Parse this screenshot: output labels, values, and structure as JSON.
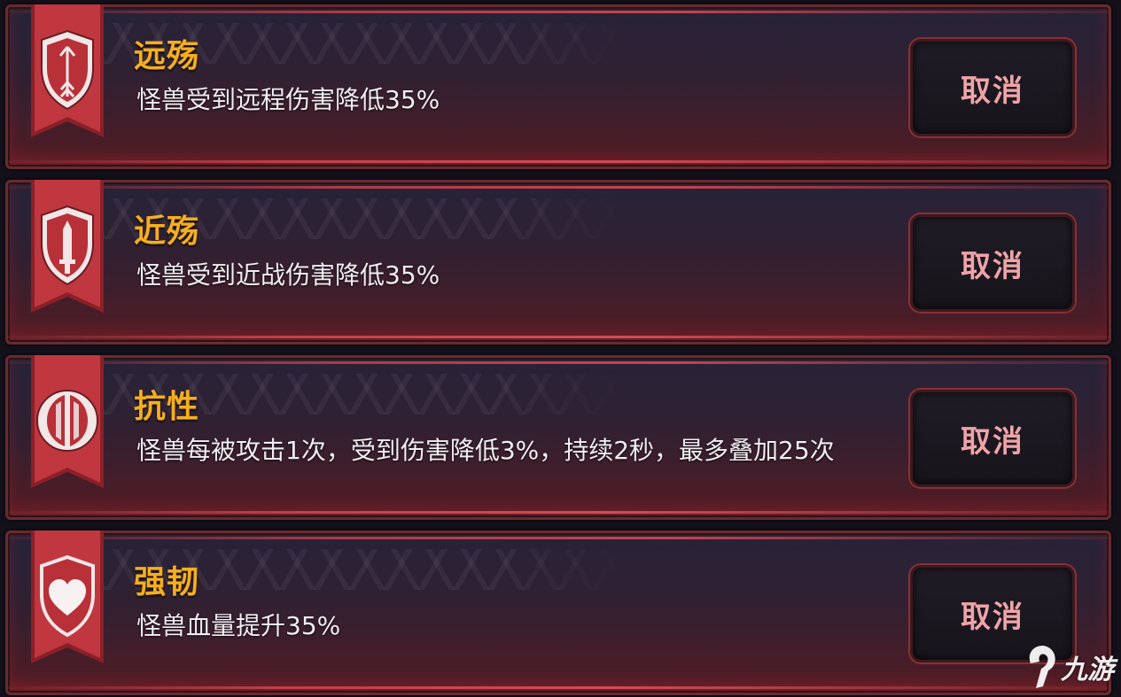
{
  "cards": [
    {
      "title": "远殇",
      "desc": "怪兽受到远程伤害降低35%",
      "button": "取消",
      "icon": "arrow-shield-icon"
    },
    {
      "title": "近殇",
      "desc": "怪兽受到近战伤害降低35%",
      "button": "取消",
      "icon": "sword-shield-icon"
    },
    {
      "title": "抗性",
      "desc": "怪兽每被攻击1次，受到伤害降低3%，持续2秒，最多叠加25次",
      "button": "取消",
      "icon": "split-shield-icon"
    },
    {
      "title": "强韧",
      "desc": "怪兽血量提升35%",
      "button": "取消",
      "icon": "heart-shield-icon"
    }
  ],
  "watermark": {
    "text": "九游"
  },
  "colors": {
    "title": "#f6ae1c",
    "banner": "#c0373f",
    "button_text": "#f0a4a8",
    "card_border": "#6a2a30"
  }
}
